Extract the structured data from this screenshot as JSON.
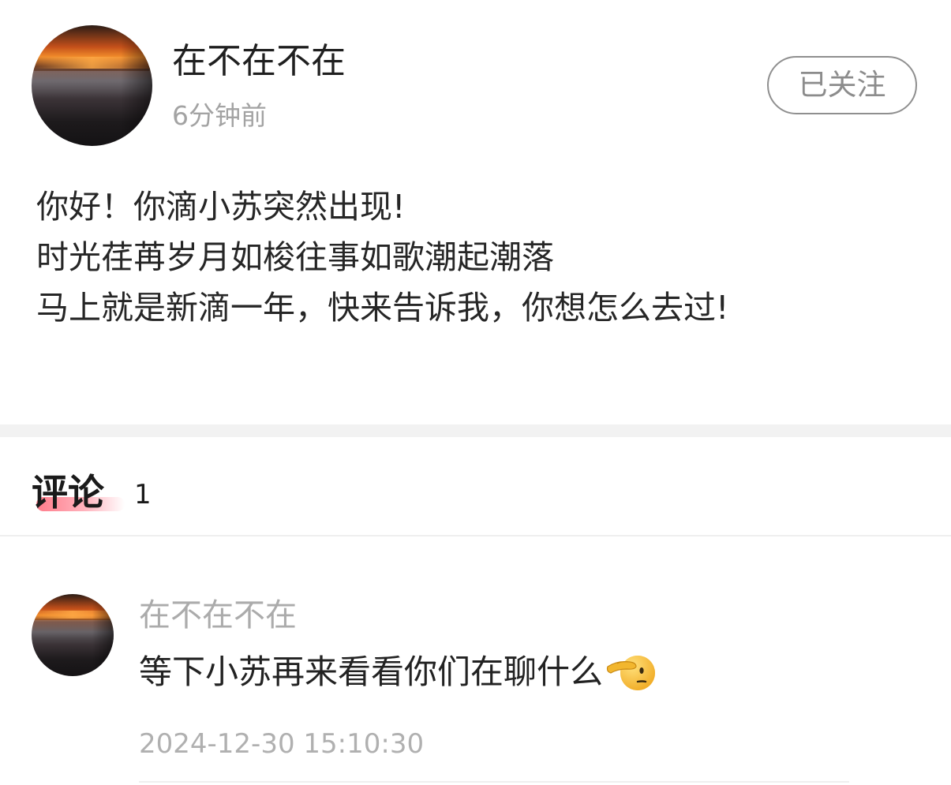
{
  "post": {
    "author_name": "在不在不在",
    "time": "6分钟前",
    "follow_label": "已关注",
    "content_lines": [
      "你好！你滴小苏突然出现!",
      "时光荏苒岁月如梭往事如歌潮起潮落",
      "马上就是新滴一年，快来告诉我，你想怎么去过!"
    ]
  },
  "comments": {
    "title": "评论",
    "count": "1",
    "items": [
      {
        "author": "在不在不在",
        "text": "等下小苏再来看看你们在聊什么",
        "emoji_icon": "saluting-face-icon",
        "timestamp": "2024-12-30 15:10:30"
      }
    ]
  },
  "colors": {
    "accent_underline": "#ff7b8a",
    "follow_border": "#8f8f8f",
    "muted_text": "#a3a3a3"
  }
}
